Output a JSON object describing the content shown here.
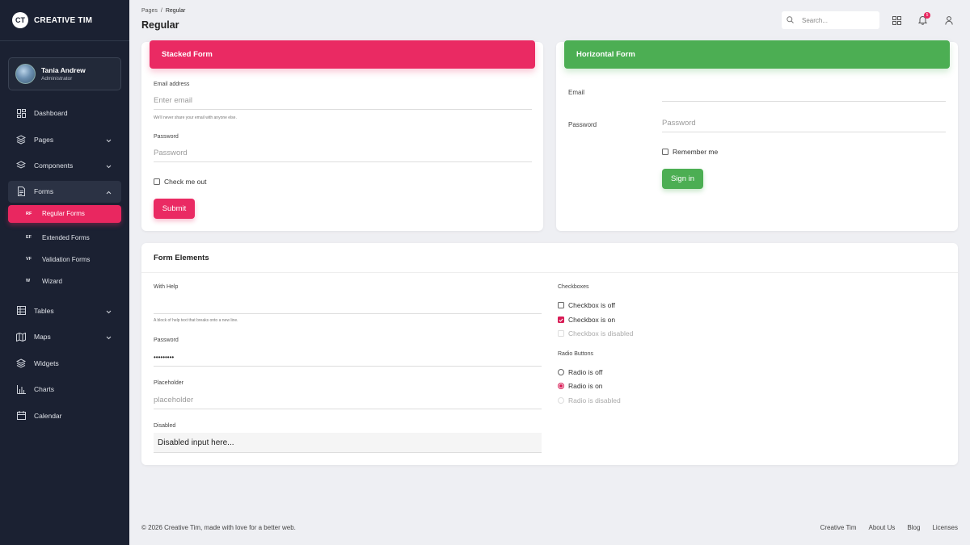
{
  "brand": {
    "logo": "CT",
    "name": "CREATIVE TIM"
  },
  "user": {
    "name": "Tania Andrew",
    "role": "Administrator"
  },
  "nav": {
    "dashboard": "Dashboard",
    "pages": "Pages",
    "components": "Components",
    "forms": "Forms",
    "tables": "Tables",
    "maps": "Maps",
    "widgets": "Widgets",
    "charts": "Charts",
    "calendar": "Calendar",
    "sub": [
      {
        "abbr": "RF",
        "label": "Regular Forms"
      },
      {
        "abbr": "EF",
        "label": "Extended Forms"
      },
      {
        "abbr": "VF",
        "label": "Validation Forms"
      },
      {
        "abbr": "W",
        "label": "Wizard"
      }
    ]
  },
  "header": {
    "breadcrumb_root": "Pages",
    "breadcrumb_sep": "/",
    "breadcrumb_current": "Regular",
    "title": "Regular",
    "search_placeholder": "Search...",
    "notification_count": "5"
  },
  "stacked": {
    "title": "Stacked Form",
    "email_label": "Email address",
    "email_placeholder": "Enter email",
    "email_help": "We'll never share your email with anyone else.",
    "password_label": "Password",
    "password_placeholder": "Password",
    "check_label": "Check me out",
    "submit": "Submit"
  },
  "horizontal": {
    "title": "Horizontal Form",
    "email_label": "Email",
    "password_label": "Password",
    "password_placeholder": "Password",
    "remember_label": "Remember me",
    "signin": "Sign in"
  },
  "elements": {
    "title": "Form Elements",
    "with_help_label": "With Help",
    "with_help_text": "A block of help text that breaks onto a new line.",
    "password_label": "Password",
    "password_value": "•••••••••",
    "placeholder_label": "Placeholder",
    "placeholder_placeholder": "placeholder",
    "disabled_label": "Disabled",
    "disabled_value": "Disabled input here...",
    "checkboxes_label": "Checkboxes",
    "checkbox_off": "Checkbox is off",
    "checkbox_on": "Checkbox is on",
    "checkbox_disabled": "Checkbox is disabled",
    "radios_label": "Radio Buttons",
    "radio_off": "Radio is off",
    "radio_on": "Radio is on",
    "radio_disabled": "Radio is disabled"
  },
  "footer": {
    "copyright": "© 2026 Creative Tim, made with love for a better web.",
    "links": [
      "Creative Tim",
      "About Us",
      "Blog",
      "Licenses"
    ]
  },
  "colors": {
    "sidebar": "#1b2132",
    "accent_pink": "#ea2a63",
    "accent_green": "#4cae53",
    "background": "#eeeff3"
  }
}
